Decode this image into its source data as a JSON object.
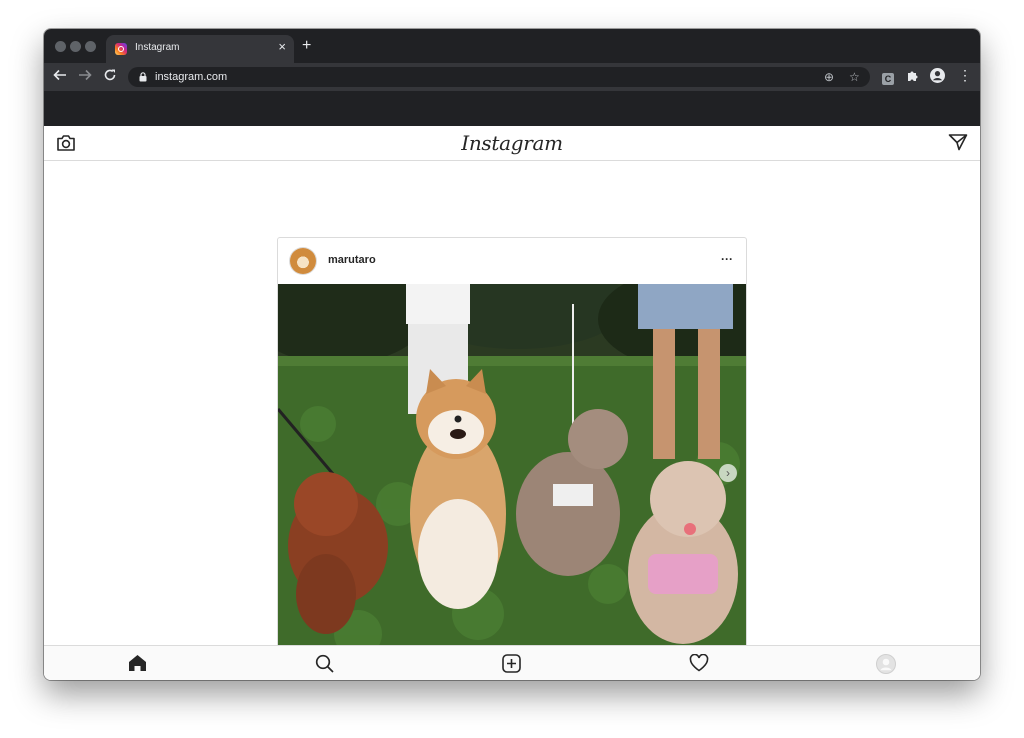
{
  "browser": {
    "tab": {
      "title": "Instagram",
      "close": "×",
      "favicon": "instagram-favicon-icon"
    },
    "new_tab": "+",
    "toolbar": {
      "back": "←",
      "forward": "→",
      "reload": "C",
      "url": "instagram.com",
      "add_icon": "⊕",
      "star_icon": "☆",
      "extension_letter": "C",
      "menu": "⋮"
    }
  },
  "instagram": {
    "logo": "Instagram",
    "post": {
      "username": "marutaro",
      "more": "···",
      "photo_subject": "dogs",
      "next": "›"
    },
    "tabbar": [
      "home",
      "search",
      "new-post",
      "activity",
      "profile"
    ]
  },
  "colors": {
    "chrome_dark": "#202124",
    "chrome_tab": "#35363a",
    "ig_border": "#dbdbdb",
    "ig_text": "#262626"
  }
}
